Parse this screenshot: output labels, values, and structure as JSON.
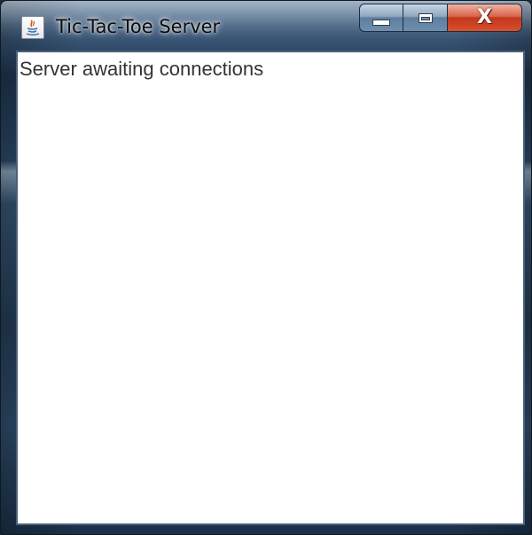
{
  "window": {
    "title": "Tic-Tac-Toe Server",
    "icon": "java-icon",
    "controls": {
      "minimize_icon": "minimize-icon",
      "maximize_icon": "maximize-icon",
      "close_label": "X"
    }
  },
  "content": {
    "log_text": "Server awaiting connections"
  }
}
